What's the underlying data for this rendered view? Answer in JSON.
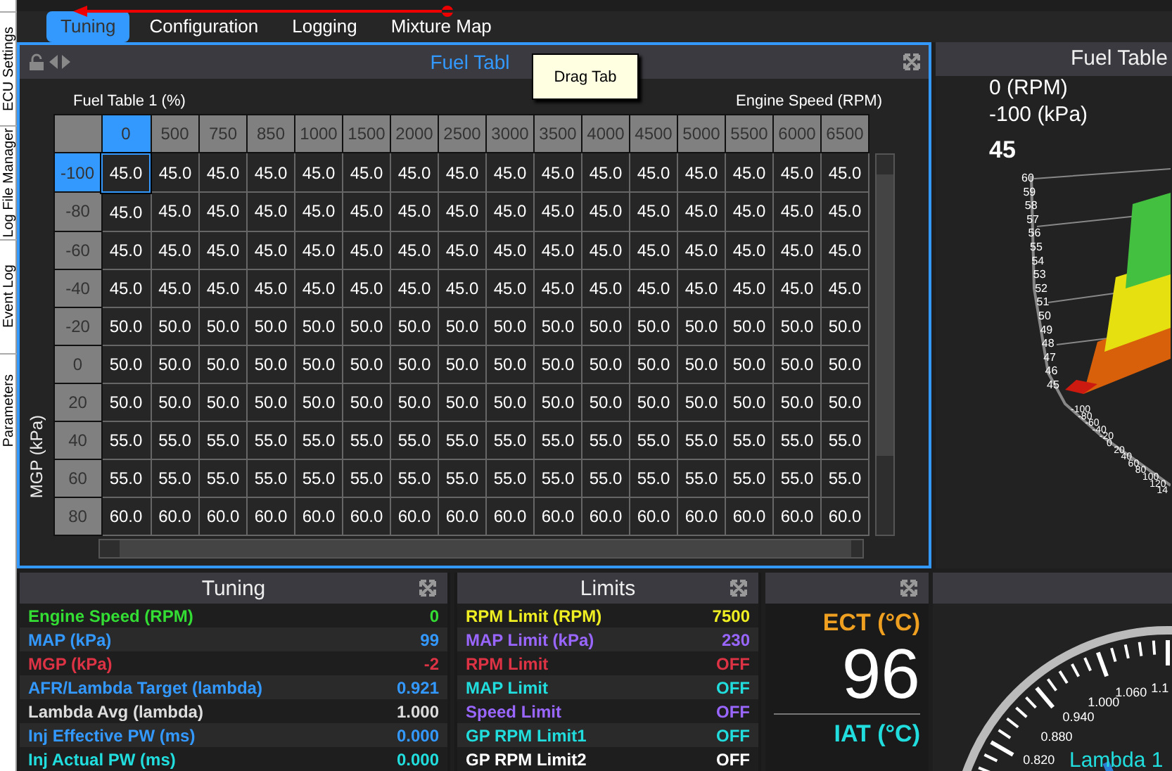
{
  "side_strip": {
    "items": [
      "Parameters",
      "Event Log",
      "Log File Manager",
      "ECU Settings"
    ]
  },
  "tabs": [
    {
      "label": "Tuning",
      "selected": true
    },
    {
      "label": "Configuration",
      "selected": false
    },
    {
      "label": "Logging",
      "selected": false
    },
    {
      "label": "Mixture Map",
      "selected": false
    }
  ],
  "tooltip": "Drag Tab",
  "fuel_table": {
    "title": "Fuel Tabl",
    "table_label": "Fuel Table 1 (%)",
    "x_axis_label": "Engine Speed (RPM)",
    "y_axis_label": "MGP (kPa)",
    "columns": [
      {
        "label": "0",
        "selected": true
      },
      {
        "label": "500",
        "selected": false
      },
      {
        "label": "750",
        "selected": false
      },
      {
        "label": "850",
        "selected": false
      },
      {
        "label": "1000",
        "selected": false
      },
      {
        "label": "1500",
        "selected": false
      },
      {
        "label": "2000",
        "selected": false
      },
      {
        "label": "2500",
        "selected": false
      },
      {
        "label": "3000",
        "selected": false
      },
      {
        "label": "3500",
        "selected": false
      },
      {
        "label": "4000",
        "selected": false
      },
      {
        "label": "4500",
        "selected": false
      },
      {
        "label": "5000",
        "selected": false
      },
      {
        "label": "5500",
        "selected": false
      },
      {
        "label": "6000",
        "selected": false
      },
      {
        "label": "6500",
        "selected": false
      }
    ],
    "rows": [
      {
        "label": "-100",
        "selected": true,
        "cells": [
          "45.0",
          "45.0",
          "45.0",
          "45.0",
          "45.0",
          "45.0",
          "45.0",
          "45.0",
          "45.0",
          "45.0",
          "45.0",
          "45.0",
          "45.0",
          "45.0",
          "45.0",
          "45.0"
        ]
      },
      {
        "label": "-80",
        "selected": false,
        "cells": [
          "45.0",
          "45.0",
          "45.0",
          "45.0",
          "45.0",
          "45.0",
          "45.0",
          "45.0",
          "45.0",
          "45.0",
          "45.0",
          "45.0",
          "45.0",
          "45.0",
          "45.0",
          "45.0"
        ]
      },
      {
        "label": "-60",
        "selected": false,
        "cells": [
          "45.0",
          "45.0",
          "45.0",
          "45.0",
          "45.0",
          "45.0",
          "45.0",
          "45.0",
          "45.0",
          "45.0",
          "45.0",
          "45.0",
          "45.0",
          "45.0",
          "45.0",
          "45.0"
        ]
      },
      {
        "label": "-40",
        "selected": false,
        "cells": [
          "45.0",
          "45.0",
          "45.0",
          "45.0",
          "45.0",
          "45.0",
          "45.0",
          "45.0",
          "45.0",
          "45.0",
          "45.0",
          "45.0",
          "45.0",
          "45.0",
          "45.0",
          "45.0"
        ]
      },
      {
        "label": "-20",
        "selected": false,
        "cells": [
          "50.0",
          "50.0",
          "50.0",
          "50.0",
          "50.0",
          "50.0",
          "50.0",
          "50.0",
          "50.0",
          "50.0",
          "50.0",
          "50.0",
          "50.0",
          "50.0",
          "50.0",
          "50.0"
        ]
      },
      {
        "label": "0",
        "selected": false,
        "cells": [
          "50.0",
          "50.0",
          "50.0",
          "50.0",
          "50.0",
          "50.0",
          "50.0",
          "50.0",
          "50.0",
          "50.0",
          "50.0",
          "50.0",
          "50.0",
          "50.0",
          "50.0",
          "50.0"
        ]
      },
      {
        "label": "20",
        "selected": false,
        "cells": [
          "50.0",
          "50.0",
          "50.0",
          "50.0",
          "50.0",
          "50.0",
          "50.0",
          "50.0",
          "50.0",
          "50.0",
          "50.0",
          "50.0",
          "50.0",
          "50.0",
          "50.0",
          "50.0"
        ]
      },
      {
        "label": "40",
        "selected": false,
        "cells": [
          "55.0",
          "55.0",
          "55.0",
          "55.0",
          "55.0",
          "55.0",
          "55.0",
          "55.0",
          "55.0",
          "55.0",
          "55.0",
          "55.0",
          "55.0",
          "55.0",
          "55.0",
          "55.0"
        ]
      },
      {
        "label": "60",
        "selected": false,
        "cells": [
          "55.0",
          "55.0",
          "55.0",
          "55.0",
          "55.0",
          "55.0",
          "55.0",
          "55.0",
          "55.0",
          "55.0",
          "55.0",
          "55.0",
          "55.0",
          "55.0",
          "55.0",
          "55.0"
        ]
      },
      {
        "label": "80",
        "selected": false,
        "cells": [
          "60.0",
          "60.0",
          "60.0",
          "60.0",
          "60.0",
          "60.0",
          "60.0",
          "60.0",
          "60.0",
          "60.0",
          "60.0",
          "60.0",
          "60.0",
          "60.0",
          "60.0",
          "60.0"
        ]
      }
    ]
  },
  "surface_panel": {
    "title": "Fuel Table",
    "rpm_readout": "0 (RPM)",
    "kpa_readout": "-100 (kPa)",
    "value_readout": "45",
    "z_labels": [
      "60",
      "59",
      "58",
      "57",
      "56",
      "55",
      "54",
      "53",
      "52",
      "51",
      "50",
      "49",
      "48",
      "47",
      "46",
      "45"
    ],
    "y_labels": [
      "-100",
      "-80",
      "-60",
      "-40",
      "-20",
      "0",
      "20",
      "40",
      "60",
      "80",
      "100",
      "120",
      "14"
    ]
  },
  "tuning_panel": {
    "title": "Tuning",
    "rows": [
      {
        "label": "Engine Speed (RPM)",
        "value": "0",
        "color": "#33dd33"
      },
      {
        "label": "MAP (kPa)",
        "value": "99",
        "color": "#3399ff"
      },
      {
        "label": "MGP (kPa)",
        "value": "-2",
        "color": "#dd3344"
      },
      {
        "label": "AFR/Lambda Target (lambda)",
        "value": "0.921",
        "color": "#3399ff"
      },
      {
        "label": "Lambda Avg (lambda)",
        "value": "1.000",
        "color": "#dddddd"
      },
      {
        "label": "Inj Effective PW (ms)",
        "value": "0.000",
        "color": "#3399ff"
      },
      {
        "label": "Inj Actual PW (ms)",
        "value": "0.000",
        "color": "#22dddd"
      }
    ]
  },
  "limits_panel": {
    "title": "Limits",
    "rows": [
      {
        "label": "RPM Limit (RPM)",
        "value": "7500",
        "color": "#eeee22"
      },
      {
        "label": "MAP Limit (kPa)",
        "value": "230",
        "color": "#9966ff"
      },
      {
        "label": "RPM Limit",
        "value": "OFF",
        "color": "#dd3344"
      },
      {
        "label": "MAP Limit",
        "value": "OFF",
        "color": "#22dddd"
      },
      {
        "label": "Speed Limit",
        "value": "OFF",
        "color": "#9966ff"
      },
      {
        "label": "GP RPM Limit1",
        "value": "OFF",
        "color": "#22dddd"
      },
      {
        "label": "GP RPM Limit2",
        "value": "OFF",
        "color": "#ffffff"
      }
    ]
  },
  "temps_panel": {
    "ect_label": "ECT (°C)",
    "ect_value": "96",
    "iat_label": "IAT (°C)"
  },
  "gauge": {
    "labels": [
      "0.820",
      "0.880",
      "0.940",
      "1.000",
      "1.060",
      "1.1"
    ],
    "title": "Lambda 1"
  }
}
